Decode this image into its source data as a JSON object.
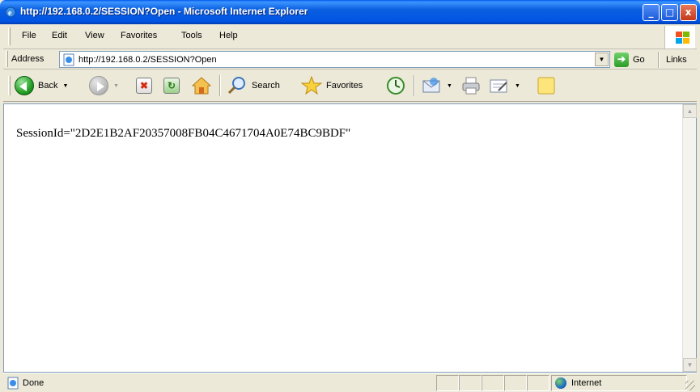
{
  "window": {
    "title": "http://192.168.0.2/SESSION?Open - Microsoft Internet Explorer",
    "min_glyph": "_",
    "max_glyph": "□",
    "close_glyph": "x"
  },
  "menu": {
    "items": [
      "File",
      "Edit",
      "View",
      "Favorites",
      "Tools",
      "Help"
    ]
  },
  "address": {
    "label": "Address",
    "url": "http://192.168.0.2/SESSION?Open",
    "go_label": "Go",
    "links_label": "Links"
  },
  "toolbar": {
    "back_label": "Back",
    "search_label": "Search",
    "favorites_label": "Favorites"
  },
  "content": {
    "text": "SessionId=\"2D2E1B2AF20357008FB04C4671704A0E74BC9BDF\""
  },
  "status": {
    "text": "Done",
    "zone": "Internet"
  },
  "colors": {
    "titlebar": "#0054e3",
    "window_bg": "#ece9d8",
    "content_bg": "#ffffff"
  }
}
